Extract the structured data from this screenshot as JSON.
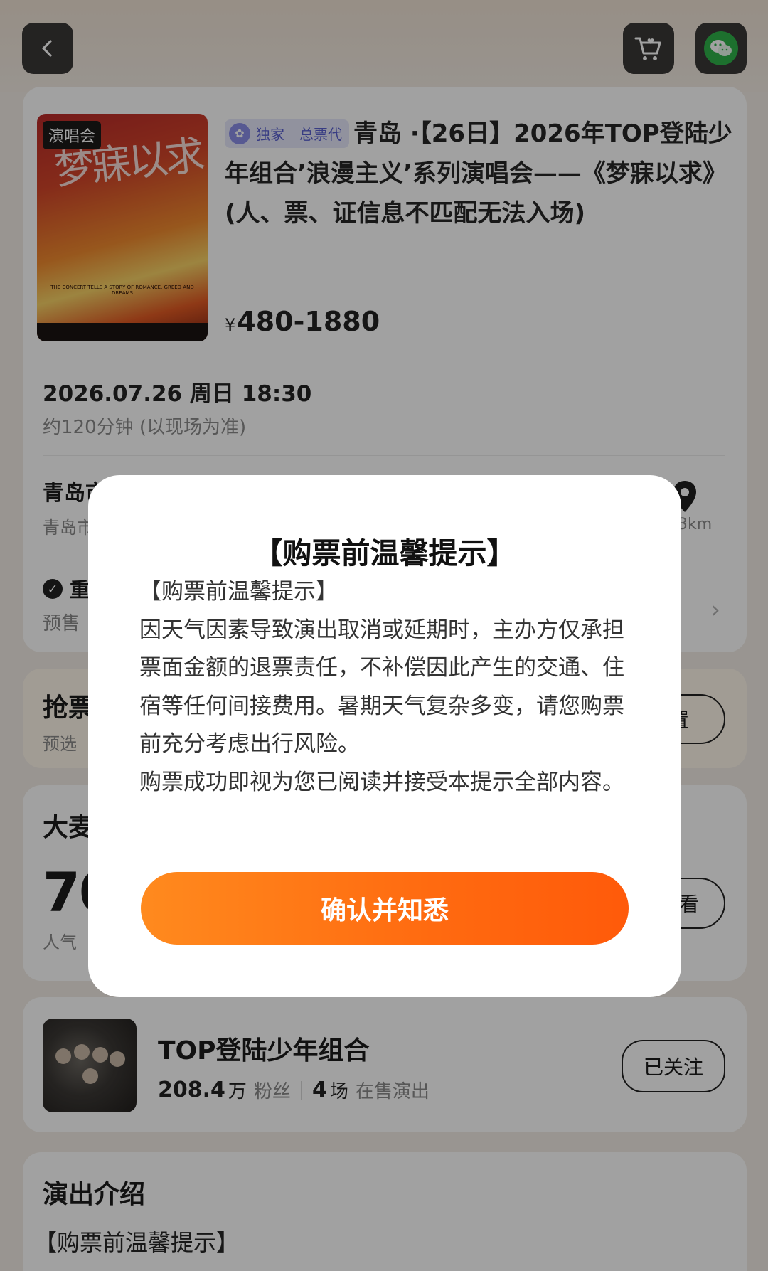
{
  "header": {
    "back_icon": "back-arrow-icon",
    "cart_icon": "cart-icon",
    "share_icon": "wechat-icon"
  },
  "event": {
    "category_badge": "演唱会",
    "poster_title": "梦寐以求",
    "tags": {
      "exclusive": "独家",
      "agent": "总票代"
    },
    "title": "青岛 ·【26日】2026年TOP登陆少年组合’浪漫主义’系列演唱会——《梦寐以求》(人、票、证信息不匹配无法入场)",
    "price_symbol": "¥",
    "price_range": "480-1880",
    "date": "2026.07.26 周日 18:30",
    "duration": "约120分钟 (以现场为准)"
  },
  "venue": {
    "name": "青岛市",
    "address": "青岛市",
    "distance": ".3km"
  },
  "notice": {
    "line1": "重",
    "line2": "预售"
  },
  "grab": {
    "title": "抢票",
    "subtitle": "预选",
    "button": "置"
  },
  "popularity": {
    "title": "大麦",
    "value": "70",
    "label": "人气",
    "button": "想看"
  },
  "artist": {
    "name": "TOP登陆少年组合",
    "fans_value": "208.4",
    "fans_unit": "万",
    "fans_label": "粉丝",
    "shows_value": "4",
    "shows_unit": "场",
    "shows_label": "在售演出",
    "follow_label": "已关注"
  },
  "intro": {
    "title": "演出介绍",
    "text": "【购票前温馨提示】"
  },
  "modal": {
    "title": "【购票前温馨提示】",
    "heading": "【购票前温馨提示】",
    "paragraph1": "因天气因素导致演出取消或延期时，主办方仅承担票面金额的退票责任，不补偿因此产生的交通、住宿等任何间接费用。暑期天气复杂多变，请您购票前充分考虑出行风险。",
    "paragraph2": "购票成功即视为您已阅读并接受本提示全部内容。",
    "confirm_label": "确认并知悉"
  }
}
